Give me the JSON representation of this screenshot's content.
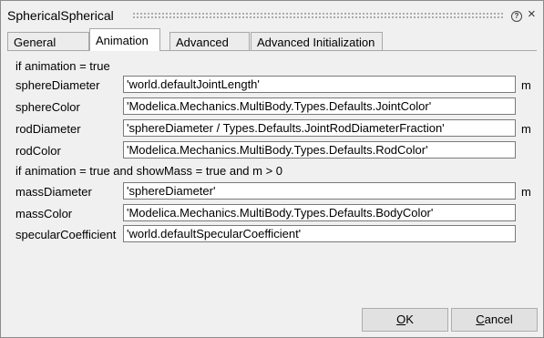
{
  "window": {
    "title": "SphericalSpherical",
    "help_icon": "question-circle-icon",
    "close_icon": "close-icon",
    "help_glyph": "?",
    "close_glyph": "×"
  },
  "tabs": [
    {
      "label": "General",
      "active": false
    },
    {
      "label": "Animation",
      "active": true
    },
    {
      "label": "Advanced",
      "active": false
    },
    {
      "label": "Advanced Initialization",
      "active": false
    }
  ],
  "sections": [
    {
      "heading": "if animation = true",
      "params": [
        {
          "label": "sphereDiameter",
          "value": "'world.defaultJointLength'",
          "unit": "m"
        },
        {
          "label": "sphereColor",
          "value": "'Modelica.Mechanics.MultiBody.Types.Defaults.JointColor'",
          "unit": ""
        },
        {
          "label": "rodDiameter",
          "value": "'sphereDiameter / Types.Defaults.JointRodDiameterFraction'",
          "unit": "m"
        },
        {
          "label": "rodColor",
          "value": "'Modelica.Mechanics.MultiBody.Types.Defaults.RodColor'",
          "unit": ""
        }
      ]
    },
    {
      "heading": "if animation = true and showMass = true and m > 0",
      "params": [
        {
          "label": "massDiameter",
          "value": "'sphereDiameter'",
          "unit": "m"
        },
        {
          "label": "massColor",
          "value": "'Modelica.Mechanics.MultiBody.Types.Defaults.BodyColor'",
          "unit": ""
        },
        {
          "label": "specularCoefficient",
          "value": "'world.defaultSpecularCoefficient'",
          "unit": ""
        }
      ]
    }
  ],
  "buttons": {
    "ok": {
      "label": "OK",
      "mnemonic": "O",
      "rest": "K"
    },
    "cancel": {
      "label": "Cancel",
      "mnemonic": "C",
      "rest": "ancel"
    }
  }
}
